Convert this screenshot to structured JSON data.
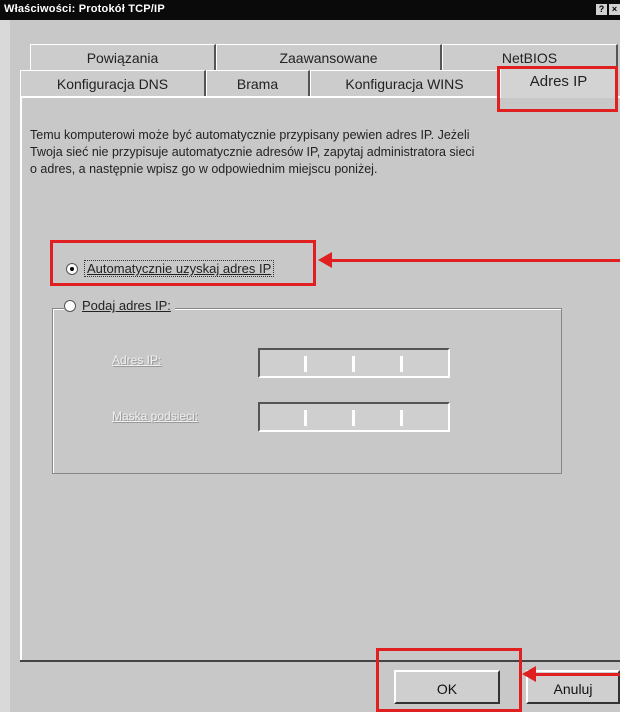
{
  "window": {
    "title": "Właściwości: Protokół TCP/IP"
  },
  "tabs_row1": [
    {
      "label": "Powiązania"
    },
    {
      "label": "Zaawansowane"
    },
    {
      "label": "NetBIOS"
    }
  ],
  "tabs_row2": [
    {
      "label": "Konfiguracja DNS"
    },
    {
      "label": "Brama"
    },
    {
      "label": "Konfiguracja WINS"
    },
    {
      "label": "Adres IP"
    }
  ],
  "description": "Temu komputerowi może być automatycznie przypisany pewien adres IP. Jeżeli Twoja sieć nie przypisuje automatycznie adresów IP, zapytaj administratora sieci o adres, a następnie wpisz go w odpowiednim miejscu poniżej.",
  "options": {
    "auto": "Automatycznie uzyskaj adres IP",
    "manual": "Podaj adres IP:"
  },
  "fields": {
    "ip_label": "Adres IP:",
    "mask_label": "Maska podsieci:"
  },
  "buttons": {
    "ok": "OK",
    "cancel": "Anuluj"
  },
  "colors": {
    "highlight": "#e02020"
  }
}
